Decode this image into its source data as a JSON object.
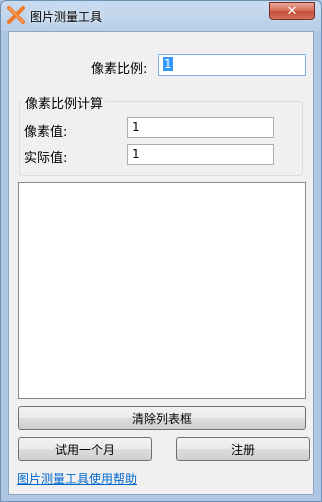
{
  "window": {
    "title": "图片测量工具",
    "close_glyph": "✕"
  },
  "scale": {
    "label": "像素比例:",
    "value": "1"
  },
  "group": {
    "title": "像素比例计算",
    "pixel_label": "像素值:",
    "pixel_value": "1",
    "actual_label": "实际值:",
    "actual_value": "1"
  },
  "buttons": {
    "clear_list": "清除列表框",
    "trial": "试用一个月",
    "register": "注册"
  },
  "help_link": "图片测量工具使用帮助",
  "colors": {
    "icon_orange": "#f07a28",
    "link": "#0066cc",
    "selection": "#3399ff"
  },
  "icons": {
    "app": "x-logo-icon",
    "close": "close-icon"
  }
}
